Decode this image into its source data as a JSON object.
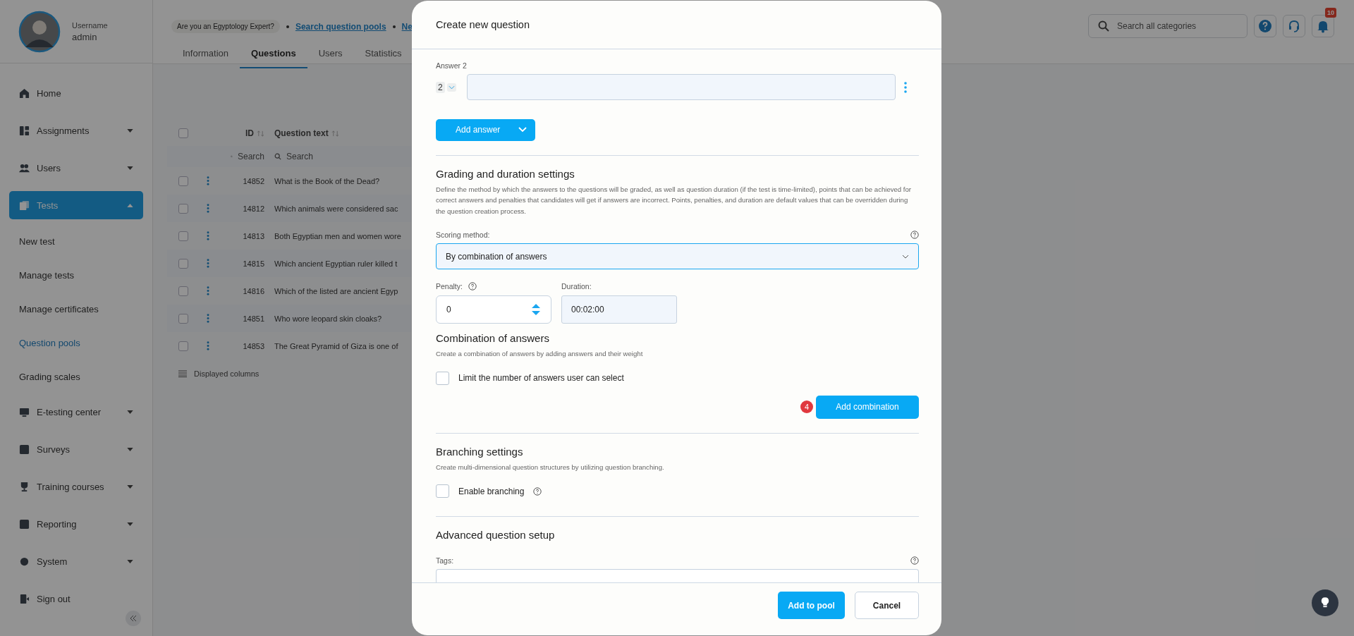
{
  "user": {
    "label": "Username",
    "name": "admin"
  },
  "breadcrumb": {
    "badge": "Are you an Egyptology Expert?",
    "links": [
      "Search question pools",
      "Ne"
    ]
  },
  "tabs": [
    {
      "label": "Information",
      "selected": false
    },
    {
      "label": "Questions",
      "selected": true
    },
    {
      "label": "Users",
      "selected": false
    },
    {
      "label": "Statistics",
      "selected": false
    }
  ],
  "search": {
    "placeholder": "Search all categories"
  },
  "notifications": {
    "count": "10"
  },
  "sidebar": {
    "items": [
      {
        "label": "Home",
        "kind": "link",
        "selected": false
      },
      {
        "label": "Assignments",
        "kind": "group",
        "expanded": false,
        "selected": false
      },
      {
        "label": "Users",
        "kind": "group",
        "expanded": false,
        "selected": false
      },
      {
        "label": "Tests",
        "kind": "group",
        "expanded": true,
        "selected": true,
        "children": [
          {
            "label": "New test",
            "selected": false
          },
          {
            "label": "Manage tests",
            "selected": false
          },
          {
            "label": "Manage certificates",
            "selected": false
          },
          {
            "label": "Question pools",
            "selected": true
          },
          {
            "label": "Grading scales",
            "selected": false
          }
        ]
      },
      {
        "label": "E-testing center",
        "kind": "group",
        "expanded": false,
        "selected": false
      },
      {
        "label": "Surveys",
        "kind": "group",
        "expanded": false,
        "selected": false
      },
      {
        "label": "Training courses",
        "kind": "group",
        "expanded": false,
        "selected": false
      },
      {
        "label": "Reporting",
        "kind": "group",
        "expanded": false,
        "selected": false
      },
      {
        "label": "System",
        "kind": "group",
        "expanded": false,
        "selected": false
      },
      {
        "label": "Sign out",
        "kind": "link",
        "selected": false
      }
    ]
  },
  "table": {
    "all_checked": false,
    "columns": [
      "ID",
      "Question text"
    ],
    "filters": [
      "Search",
      "Search"
    ],
    "rows": [
      {
        "id": "14852",
        "text": "What is the Book of the Dead?",
        "checked": false
      },
      {
        "id": "14812",
        "text": "Which animals were considered sac",
        "checked": false
      },
      {
        "id": "14813",
        "text": "Both Egyptian men and women wore",
        "checked": false
      },
      {
        "id": "14815",
        "text": "Which ancient Egyptian ruler killed t",
        "checked": false
      },
      {
        "id": "14816",
        "text": "Which of the listed are ancient Egyp",
        "checked": false
      },
      {
        "id": "14851",
        "text": "Who wore leopard skin cloaks?",
        "checked": false
      },
      {
        "id": "14853",
        "text": "The Great Pyramid of Giza is one of",
        "checked": false
      }
    ],
    "footer": "Displayed columns"
  },
  "modal": {
    "title": "Create new question",
    "answer": {
      "label": "Answer 2",
      "number": "2"
    },
    "add_answer": "Add answer",
    "grading": {
      "title": "Grading and duration settings",
      "description": "Define the method by which the answers to the questions will be graded, as well as question duration (if the test is time-limited), points that can be achieved for correct answers and penalties that candidates will get if answers are incorrect. Points, penalties, and duration are default values that can be overridden during the question creation process.",
      "scoring_label": "Scoring method:",
      "scoring_value": "By combination of answers",
      "penalty_label": "Penalty:",
      "penalty_value": "0",
      "duration_label": "Duration:",
      "duration_value": "00:02:00"
    },
    "combination": {
      "title": "Combination of answers",
      "description": "Create a combination of answers by adding answers and their weight",
      "limit": {
        "label": "Limit the number of answers user can select",
        "checked": false
      },
      "step": "4",
      "button": "Add combination"
    },
    "branching": {
      "title": "Branching settings",
      "description": "Create multi-dimensional question structures by utilizing question branching.",
      "enable": {
        "label": "Enable branching",
        "checked": false
      }
    },
    "advanced": {
      "title": "Advanced question setup",
      "tags_label": "Tags:"
    },
    "buttons": [
      "Add to pool",
      "Cancel"
    ]
  }
}
